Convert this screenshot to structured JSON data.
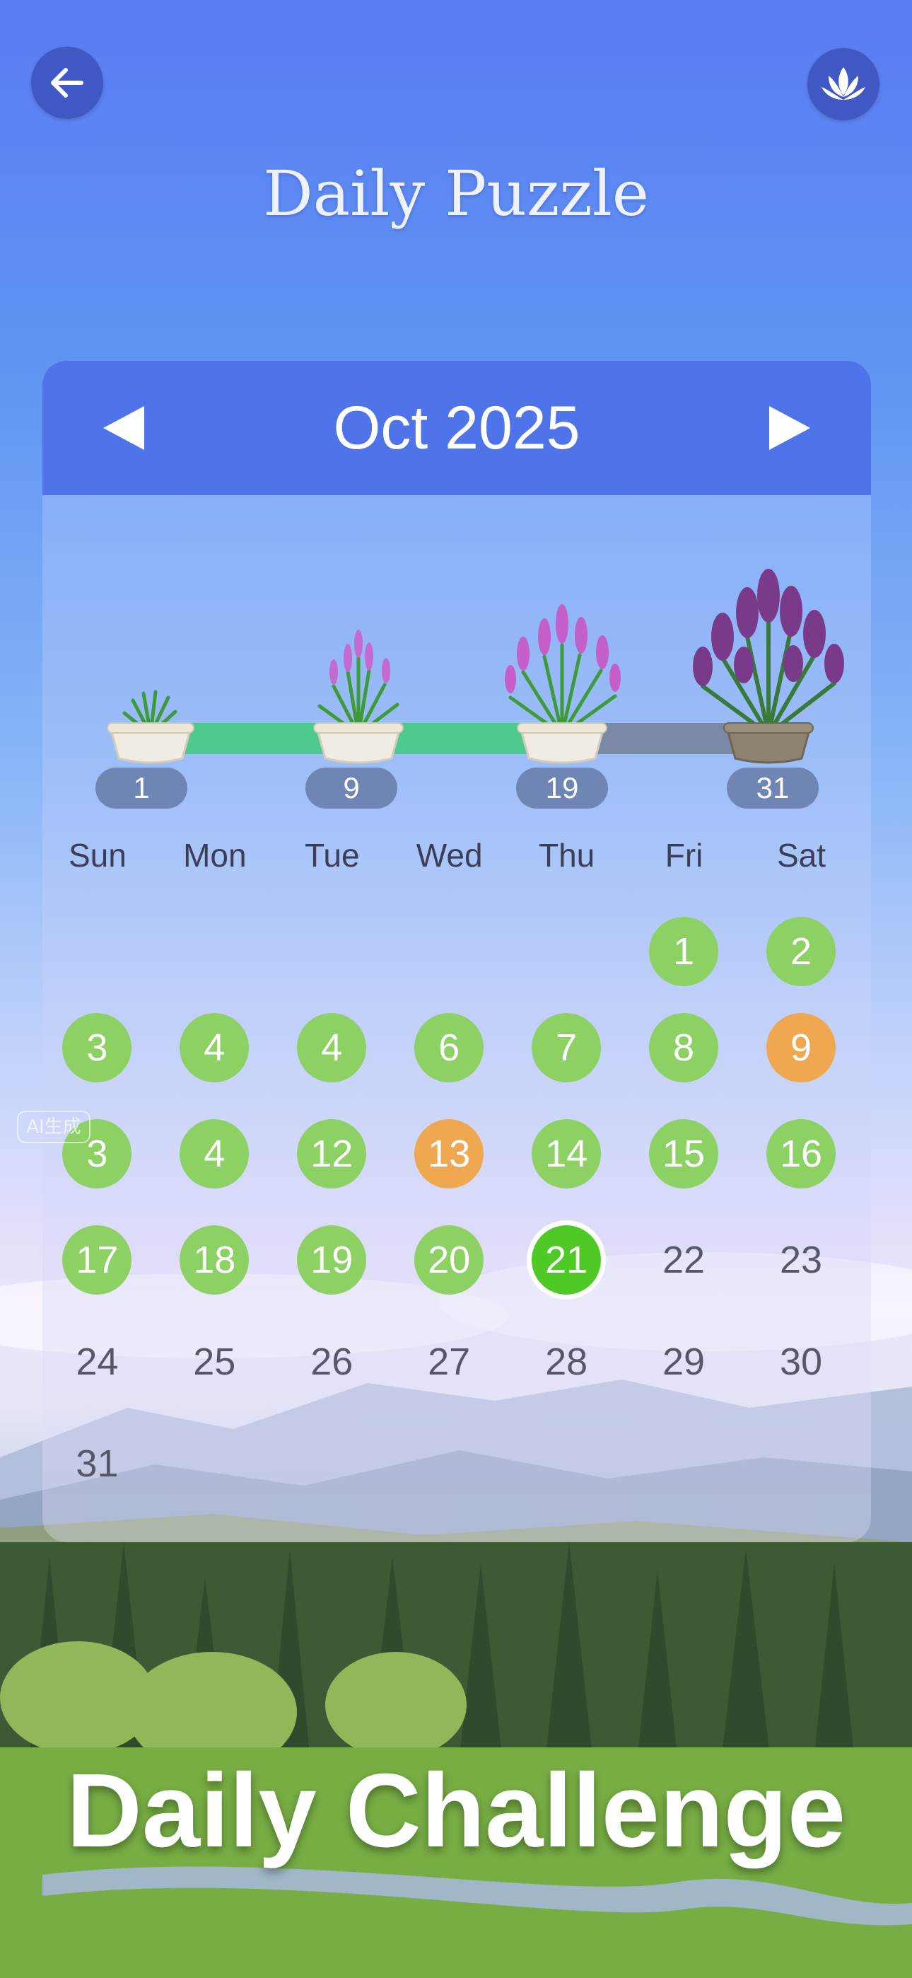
{
  "header": {
    "title": "Daily Puzzle",
    "back_icon": "arrow-left-icon",
    "profile_icon": "lotus-icon"
  },
  "calendar": {
    "month_label": "Oct 2025",
    "prev_icon": "triangle-left-icon",
    "next_icon": "triangle-right-icon",
    "progress": {
      "fraction": 0.68,
      "milestones": [
        {
          "day": "1",
          "reached": true
        },
        {
          "day": "9",
          "reached": true
        },
        {
          "day": "19",
          "reached": true
        },
        {
          "day": "31",
          "reached": false
        }
      ]
    },
    "weekdays": [
      "Sun",
      "Mon",
      "Tue",
      "Wed",
      "Thu",
      "Fri",
      "Sat"
    ],
    "weeks": [
      [
        {
          "label": "",
          "state": "empty"
        },
        {
          "label": "",
          "state": "empty"
        },
        {
          "label": "",
          "state": "empty"
        },
        {
          "label": "",
          "state": "empty"
        },
        {
          "label": "",
          "state": "empty"
        },
        {
          "label": "1",
          "state": "done"
        },
        {
          "label": "2",
          "state": "done"
        }
      ],
      [
        {
          "label": "3",
          "state": "done"
        },
        {
          "label": "4",
          "state": "done"
        },
        {
          "label": "4",
          "state": "done"
        },
        {
          "label": "6",
          "state": "done"
        },
        {
          "label": "7",
          "state": "done"
        },
        {
          "label": "8",
          "state": "done"
        },
        {
          "label": "9",
          "state": "partial"
        }
      ],
      [
        {
          "label": "3",
          "state": "done"
        },
        {
          "label": "4",
          "state": "done"
        },
        {
          "label": "12",
          "state": "done"
        },
        {
          "label": "13",
          "state": "partial"
        },
        {
          "label": "14",
          "state": "done"
        },
        {
          "label": "15",
          "state": "done"
        },
        {
          "label": "16",
          "state": "done"
        }
      ],
      [
        {
          "label": "17",
          "state": "done"
        },
        {
          "label": "18",
          "state": "done"
        },
        {
          "label": "19",
          "state": "done"
        },
        {
          "label": "20",
          "state": "done"
        },
        {
          "label": "21",
          "state": "today"
        },
        {
          "label": "22",
          "state": "future"
        },
        {
          "label": "23",
          "state": "future"
        }
      ],
      [
        {
          "label": "24",
          "state": "future"
        },
        {
          "label": "25",
          "state": "future"
        },
        {
          "label": "26",
          "state": "future"
        },
        {
          "label": "27",
          "state": "future"
        },
        {
          "label": "28",
          "state": "future"
        },
        {
          "label": "29",
          "state": "future"
        },
        {
          "label": "30",
          "state": "future"
        }
      ],
      [
        {
          "label": "31",
          "state": "future"
        },
        {
          "label": "",
          "state": "empty"
        },
        {
          "label": "",
          "state": "empty"
        },
        {
          "label": "",
          "state": "empty"
        },
        {
          "label": "",
          "state": "empty"
        },
        {
          "label": "",
          "state": "empty"
        },
        {
          "label": "",
          "state": "empty"
        }
      ]
    ]
  },
  "footer": {
    "banner": "Daily Challenge"
  },
  "watermark": "AI生成",
  "colors": {
    "done": "#8dd063",
    "partial": "#efa84f",
    "today": "#4fc926",
    "header": "#4f74ea",
    "track_done": "#4ec98f",
    "track_todo": "#7a8aa6"
  }
}
